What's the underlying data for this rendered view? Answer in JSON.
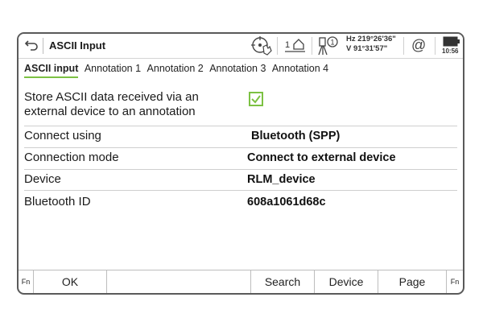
{
  "app": {
    "title": "ASCII Input"
  },
  "status": {
    "hz": "Hz 219°26'36\"",
    "v": "V  91°31'57\"",
    "target_number": "1",
    "level_number": "1",
    "clock": "10:56"
  },
  "tabs": [
    {
      "label": "ASCII input",
      "active": true
    },
    {
      "label": "Annotation 1",
      "active": false
    },
    {
      "label": "Annotation 2",
      "active": false
    },
    {
      "label": "Annotation 3",
      "active": false
    },
    {
      "label": "Annotation 4",
      "active": false
    }
  ],
  "settings": {
    "store_label_line1": "Store ASCII data received via an",
    "store_label_line2": "external device to an annotation",
    "store_checked": true,
    "connect_using_label": "Connect using",
    "connect_using_value": "Bluetooth (SPP)",
    "connection_mode_label": "Connection mode",
    "connection_mode_value": "Connect to external device",
    "device_label": "Device",
    "device_value": "RLM_device",
    "bluetooth_id_label": "Bluetooth ID",
    "bluetooth_id_value": "608a1061d68c"
  },
  "footer": {
    "fn_left": "Fn",
    "ok": "OK",
    "search": "Search",
    "device": "Device",
    "page": "Page",
    "fn_right": "Fn"
  },
  "colors": {
    "accent": "#7cc143",
    "frame": "#5a5a5a"
  }
}
